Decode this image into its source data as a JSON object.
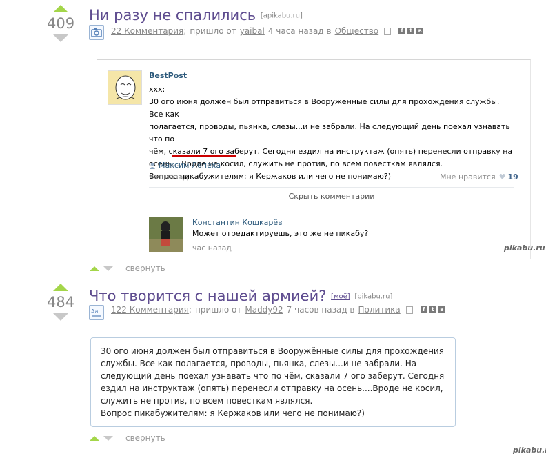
{
  "posts": [
    {
      "score": "409",
      "title": "Ни разу не спалились",
      "domain_tag": "[apikabu.ru]",
      "comments": "22 Комментария",
      "sep": ";",
      "from_label": "пришло от",
      "author": "yaibal",
      "time": "4 часа назад в",
      "category": "Общество",
      "collapse": "свернуть"
    },
    {
      "score": "484",
      "title": "Что творится с нашей армией?",
      "mine_tag": "[моё]",
      "domain_tag": "[pikabu.ru]",
      "comments": "122 Комментария",
      "sep": ";",
      "from_label": "пришло от",
      "author": "Maddy92",
      "time": "7 часов назад в",
      "category": "Политика",
      "collapse": "свернуть",
      "quote": [
        "30 ого июня должен был отправиться в Вооружённые силы для прохождения",
        "службы. Все как полагается, проводы, пьянка, слезы...и не забрали. На",
        "следующий день поехал узнавать что по чём, сказали 7 ого заберут. Сегодня",
        "ездил на инструктаж (опять) перенесли отправку на осень....Вроде не косил,",
        "служить не против, по всем повесткам являлся.",
        "Вопрос пикабужителям: я Кержаков или чего не понимаю?)"
      ]
    }
  ],
  "social": {
    "fb": "f",
    "tw": "t",
    "vk": "в"
  },
  "vk_post": {
    "author": "BestPost",
    "lines": [
      "ххх:",
      "30 ого июня должен был отправиться в Вооружённые силы для прохождения службы. Все как",
      "полагается, проводы, пьянка, слезы...и не забрали. На следующий день поехал узнавать что по",
      "чём, сказали 7 ого заберут. Сегодня ездил на инструктаж (опять) перенесли отправку на",
      "осень....Вроде не косил, служить не против, по всем повесткам являлся.",
      "Вопрос пикабужителям: я Кержаков или чего не понимаю?)"
    ],
    "signed": "Максим Лепеха",
    "time": "час назад",
    "like_label": "Мне нравится",
    "like_count": "19",
    "hide_comments": "Скрыть комментарии",
    "comment": {
      "author": "Константин Кошкарёв",
      "text": "Может отредактируешь, это же не пикабу?",
      "time": "час назад"
    }
  },
  "watermark": "pikabu.ru",
  "colors": {
    "accent_green": "#a4d64a",
    "title_purple": "#5e4c8f",
    "vk_blue": "#2b587a",
    "underline_red": "#cc0000"
  }
}
